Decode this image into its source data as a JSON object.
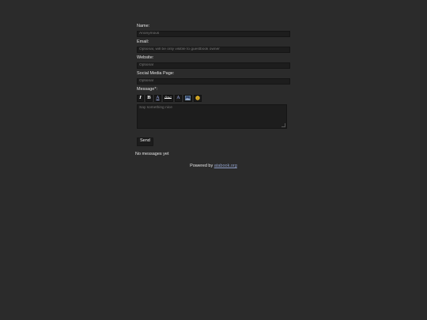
{
  "form": {
    "name_label": "Name:",
    "name_placeholder": "Anonymous",
    "email_label": "Email:",
    "email_placeholder": "Optional, will be only visible to guestbook owner",
    "website_label": "Website:",
    "website_placeholder": "Optional",
    "social_label": "Social Media Page:",
    "social_placeholder": "Optional",
    "message_label": "Message*:",
    "message_placeholder": "Say something nice",
    "send_label": "Send"
  },
  "toolbar": {
    "italic": "I",
    "bold": "B",
    "underline_letter": "A",
    "strike": "/inc",
    "spoiler_letter": "A",
    "image_icon": "image-icon",
    "emoji_icon": "emoji-icon"
  },
  "messages": {
    "empty_text": "No messages yet"
  },
  "footer": {
    "prefix": "Powered by",
    "link_text": "atabook.org"
  },
  "colors": {
    "background": "#2b2b2b",
    "input_bg": "#1d1d1d",
    "link": "#8f9fc8",
    "emoji": "#e6b422"
  }
}
